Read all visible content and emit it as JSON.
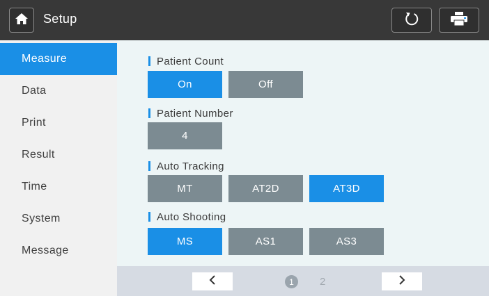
{
  "header": {
    "title": "Setup",
    "home_icon": "home-icon",
    "refresh_icon": "refresh-icon",
    "print_icon": "printer-icon"
  },
  "sidebar": {
    "items": [
      {
        "label": "Measure",
        "active": true
      },
      {
        "label": "Data",
        "active": false
      },
      {
        "label": "Print",
        "active": false
      },
      {
        "label": "Result",
        "active": false
      },
      {
        "label": "Time",
        "active": false
      },
      {
        "label": "System",
        "active": false
      },
      {
        "label": "Message",
        "active": false
      }
    ]
  },
  "sections": {
    "patient_count": {
      "label": "Patient Count",
      "options": [
        "On",
        "Off"
      ],
      "selected": "On"
    },
    "patient_number": {
      "label": "Patient Number",
      "value": "4"
    },
    "auto_tracking": {
      "label": "Auto Tracking",
      "options": [
        "MT",
        "AT2D",
        "AT3D"
      ],
      "selected": "AT3D"
    },
    "auto_shooting": {
      "label": "Auto Shooting",
      "options": [
        "MS",
        "AS1",
        "AS3"
      ],
      "selected": "MS"
    }
  },
  "pager": {
    "prev_icon": "chevron-left-icon",
    "next_icon": "chevron-right-icon",
    "pages": [
      "1",
      "2"
    ],
    "current": "1"
  },
  "colors": {
    "accent": "#1a8fe6",
    "option_inactive": "#7c8b92",
    "topbar": "#383838"
  }
}
